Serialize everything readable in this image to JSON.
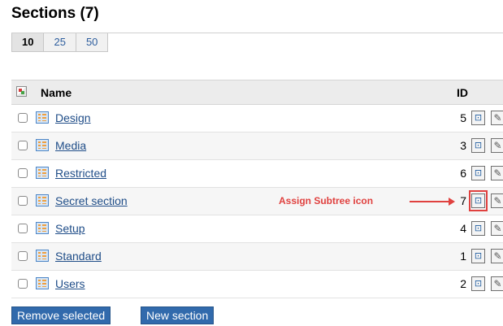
{
  "page": {
    "title": "Sections (7)"
  },
  "pager": [
    "10",
    "25",
    "50"
  ],
  "table": {
    "headers": {
      "name": "Name",
      "id": "ID"
    },
    "rows": [
      {
        "name": "Design",
        "id": "5"
      },
      {
        "name": "Media",
        "id": "3"
      },
      {
        "name": "Restricted",
        "id": "6"
      },
      {
        "name": "Secret section",
        "id": "7"
      },
      {
        "name": "Setup",
        "id": "4"
      },
      {
        "name": "Standard",
        "id": "1"
      },
      {
        "name": "Users",
        "id": "2"
      }
    ]
  },
  "annotation": {
    "label": "Assign Subtree icon",
    "color": "#e0413f"
  },
  "buttons": {
    "remove": "Remove selected",
    "new": "New section"
  },
  "colors": {
    "accent": "#316aac",
    "link": "#1f4d88"
  }
}
